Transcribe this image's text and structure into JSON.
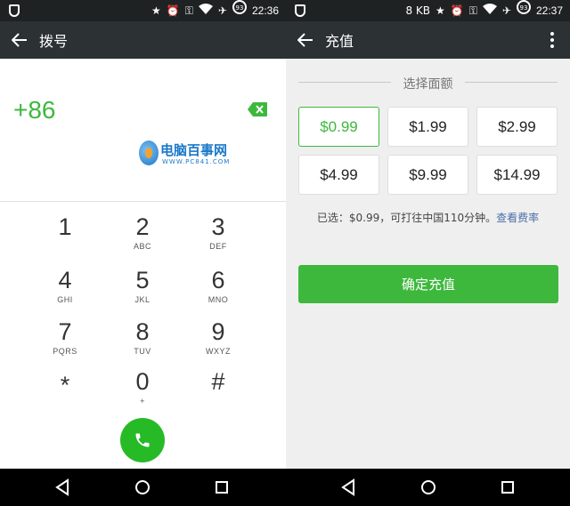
{
  "left": {
    "status": {
      "time": "22:36",
      "icons": [
        "shield-icon",
        "star-icon",
        "alarm-icon",
        "key-icon",
        "wifi-icon",
        "airplane-icon",
        "battery-icon"
      ],
      "battery": "93"
    },
    "appbar": {
      "title": "拨号"
    },
    "dial": {
      "number": "+86"
    },
    "watermark": {
      "brand": "电脑百事网",
      "url": "WWW.PC841.COM"
    },
    "keypad": [
      {
        "digit": "1",
        "letters": ""
      },
      {
        "digit": "2",
        "letters": "ABC"
      },
      {
        "digit": "3",
        "letters": "DEF"
      },
      {
        "digit": "4",
        "letters": "GHI"
      },
      {
        "digit": "5",
        "letters": "JKL"
      },
      {
        "digit": "6",
        "letters": "MNO"
      },
      {
        "digit": "7",
        "letters": "PQRS"
      },
      {
        "digit": "8",
        "letters": "TUV"
      },
      {
        "digit": "9",
        "letters": "WXYZ"
      },
      {
        "digit": "*",
        "letters": ""
      },
      {
        "digit": "0",
        "letters": "+"
      },
      {
        "digit": "#",
        "letters": ""
      }
    ]
  },
  "right": {
    "status": {
      "time": "22:37",
      "speed": "8 KB",
      "battery": "93"
    },
    "appbar": {
      "title": "充值"
    },
    "section_title": "选择面额",
    "amounts": [
      "$0.99",
      "$1.99",
      "$2.99",
      "$4.99",
      "$9.99",
      "$14.99"
    ],
    "selected_index": 0,
    "selected_text": "已选：$0.99，可打往中国110分钟。",
    "rates_link": "查看费率",
    "confirm_label": "确定充值"
  },
  "colors": {
    "accent_green": "#3db83d",
    "call_green": "#27ba27",
    "appbar_bg": "#2c3134",
    "status_bg": "#1f2223",
    "link_blue": "#4a6ea9"
  }
}
